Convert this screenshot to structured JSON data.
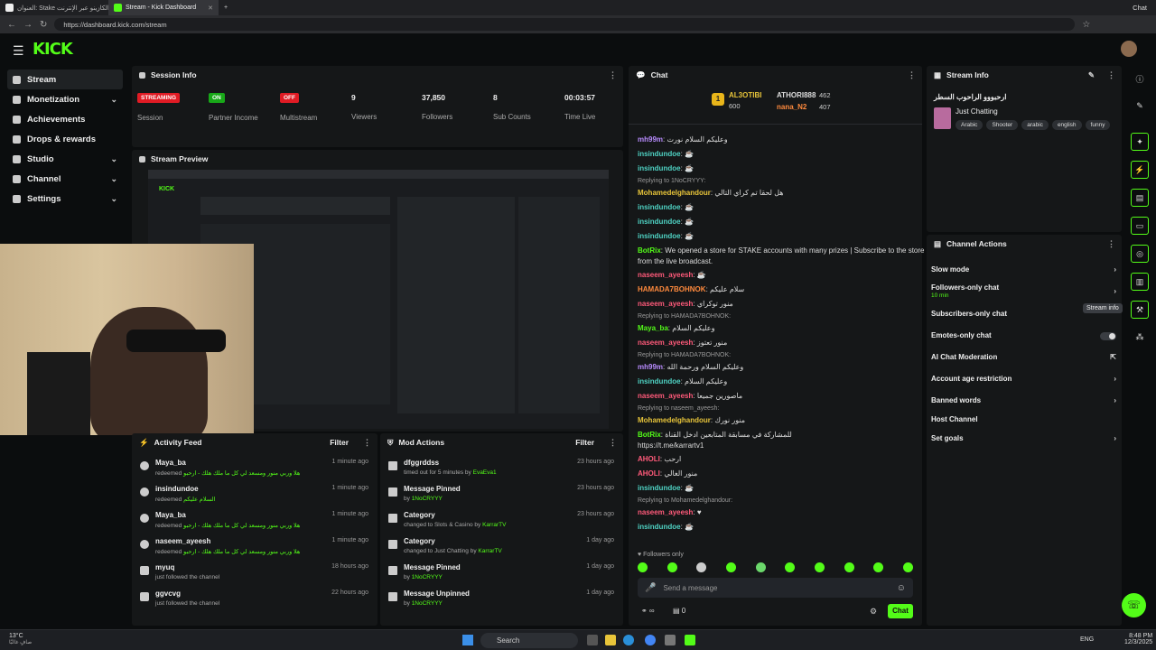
{
  "browser": {
    "tabs": [
      {
        "label": "العنوان: Stake الكازينو عبر الإنترنت"
      },
      {
        "label": "Stream - Kick Dashboard"
      }
    ],
    "url": "https://dashboard.kick.com/stream",
    "profile_label": "Chat"
  },
  "brand": {
    "logo": "KICK",
    "accent": "#53fc18"
  },
  "sidebar": {
    "items": [
      {
        "label": "Stream",
        "icon": "stream-icon"
      },
      {
        "label": "Monetization",
        "icon": "dollar-icon"
      },
      {
        "label": "Achievements",
        "icon": "trophy-icon"
      },
      {
        "label": "Drops & rewards",
        "icon": "gift-icon"
      },
      {
        "label": "Studio",
        "icon": "studio-icon"
      },
      {
        "label": "Channel",
        "icon": "channel-icon"
      },
      {
        "label": "Settings",
        "icon": "gear-icon"
      }
    ]
  },
  "session": {
    "title": "Session Info",
    "stats": [
      {
        "value": "STREAMING",
        "label": "Session",
        "color": "#e01b24"
      },
      {
        "value": "ON",
        "label": "Partner Income",
        "color": "#18a818"
      },
      {
        "value": "OFF",
        "label": "Multistream",
        "color": "#e01b24"
      },
      {
        "value": "9",
        "label": "Viewers"
      },
      {
        "value": "37,850",
        "label": "Followers"
      },
      {
        "value": "8",
        "label": "Sub Counts"
      },
      {
        "value": "00:03:57",
        "label": "Time Live"
      }
    ]
  },
  "preview": {
    "title": "Stream Preview"
  },
  "activity": {
    "title": "Activity Feed",
    "filter": "Filter",
    "rows": [
      {
        "name": "Maya_ba",
        "action": "redeemed",
        "reward": "هلا وربي منور ومسعد لي كل ما ملك هلك - ارحبو",
        "time": "1 minute ago"
      },
      {
        "name": "insindundoe",
        "action": "redeemed",
        "reward": "السلام عليكم",
        "time": "1 minute ago"
      },
      {
        "name": "Maya_ba",
        "action": "redeemed",
        "reward": "هلا وربي منور ومسعد لي كل ما ملك هلك - ارحبو",
        "time": "1 minute ago"
      },
      {
        "name": "naseem_ayeesh",
        "action": "redeemed",
        "reward": "هلا وربي منور ومسعد لي كل ما ملك هلك - ارحبو",
        "time": "1 minute ago"
      },
      {
        "name": "myuq",
        "action": "just followed the channel",
        "reward": "",
        "time": "18 hours ago"
      },
      {
        "name": "ggvcvg",
        "action": "just followed the channel",
        "reward": "",
        "time": "22 hours ago"
      }
    ]
  },
  "mod": {
    "title": "Mod Actions",
    "filter": "Filter",
    "rows": [
      {
        "title": "dfggrddss",
        "detail": "timed out for 5 minutes by",
        "by": "EvaEva1",
        "time": "23 hours ago",
        "icon": "hourglass-icon"
      },
      {
        "title": "Message Pinned",
        "detail": "by",
        "by": "1NoCRYYY",
        "time": "23 hours ago",
        "icon": "pin-icon"
      },
      {
        "title": "Category",
        "detail": "changed to Slots & Casino by",
        "by": "KarrarTV",
        "time": "23 hours ago",
        "icon": "category-icon"
      },
      {
        "title": "Category",
        "detail": "changed to Just Chatting by",
        "by": "KarrarTV",
        "time": "1 day ago",
        "icon": "category-icon"
      },
      {
        "title": "Message Pinned",
        "detail": "by",
        "by": "1NoCRYYY",
        "time": "1 day ago",
        "icon": "pin-icon"
      },
      {
        "title": "Message Unpinned",
        "detail": "by",
        "by": "1NoCRYYY",
        "time": "1 day ago",
        "icon": "unpin-icon"
      }
    ]
  },
  "chat": {
    "title": "Chat",
    "top": [
      {
        "rank": "1",
        "name": "AL3OTIBI",
        "score": "600"
      },
      {
        "rank": "",
        "name": "ATHORI888",
        "score": "462"
      },
      {
        "rank": "",
        "name": "nana_N2",
        "score": "407"
      }
    ],
    "messages": [
      {
        "user": "mh99m",
        "text": "وعليكم السلام نورت",
        "color": "#b98cff"
      },
      {
        "user": "insindundoe",
        "text": "☕",
        "color": "#4fd3c4"
      },
      {
        "user": "insindundoe",
        "text": "☕",
        "color": "#4fd3c4"
      },
      {
        "reply": "Replying to 1NoCRYYY:"
      },
      {
        "user": "Mohamedelghandour",
        "text": "هل لحقا تم كراي التالي",
        "color": "#e8c53a"
      },
      {
        "user": "insindundoe",
        "text": "☕",
        "color": "#4fd3c4"
      },
      {
        "user": "insindundoe",
        "text": "☕",
        "color": "#4fd3c4"
      },
      {
        "user": "insindundoe",
        "text": "☕",
        "color": "#4fd3c4"
      },
      {
        "user": "BotRix",
        "text": "We opened a store for STAKE accounts with many prizes | Subscribe to the store and collect points",
        "color": "#53fc18"
      },
      {
        "cont": "from the live broadcast."
      },
      {
        "user": "naseem_ayeesh",
        "text": "☕",
        "color": "#ff5a7a"
      },
      {
        "user": "HAMADA7BOHNOK",
        "text": "سلام عليكم",
        "color": "#ff8a3d"
      },
      {
        "user": "naseem_ayeesh",
        "text": "منور توكراي",
        "color": "#ff5a7a"
      },
      {
        "reply": "Replying to HAMADA7BOHNOK:"
      },
      {
        "user": "Maya_ba",
        "text": "وعليكم السلام",
        "color": "#53fc18"
      },
      {
        "user": "naseem_ayeesh",
        "text": "منور تعتوز",
        "color": "#ff5a7a"
      },
      {
        "reply": "Replying to HAMADA7BOHNOK:"
      },
      {
        "user": "mh99m",
        "text": "وعليكم السلام ورحمة الله",
        "color": "#b98cff"
      },
      {
        "user": "insindundoe",
        "text": "وعليكم السلام",
        "color": "#4fd3c4"
      },
      {
        "user": "naseem_ayeesh",
        "text": "ماصورين جميعا",
        "color": "#ff5a7a"
      },
      {
        "reply": "Replying to naseem_ayeesh:"
      },
      {
        "user": "Mohamedelghandour",
        "text": "منور نورك",
        "color": "#e8c53a"
      },
      {
        "user": "BotRix",
        "text": "للمشاركة في مسابقة المتابعين ادخل القناة",
        "color": "#53fc18"
      },
      {
        "cont": "https://t.me/karrartv1"
      },
      {
        "user": "AHOLI",
        "text": "ارحب",
        "color": "#ff5a7a"
      },
      {
        "user": "AHOLI",
        "text": "منور الغالي",
        "color": "#ff5a7a"
      },
      {
        "user": "insindundoe",
        "text": "☕",
        "color": "#4fd3c4"
      },
      {
        "reply": "Replying to Mohamedelghandour:"
      },
      {
        "user": "naseem_ayeesh",
        "text": "♥",
        "color": "#ff5a7a"
      },
      {
        "user": "insindundoe",
        "text": "☕",
        "color": "#4fd3c4"
      }
    ],
    "followers_only": "Followers only",
    "placeholder": "Send a message",
    "count": "0",
    "send": "Chat"
  },
  "stream_info": {
    "title": "Stream Info",
    "stream_title": "ارحبووو الراحوب السطر",
    "category": "Just Chatting",
    "tags": [
      "Arabic",
      "Shooter",
      "arabic",
      "english",
      "funny"
    ]
  },
  "channel_actions": {
    "title": "Channel Actions",
    "items": [
      {
        "label": "Slow mode",
        "sub": ""
      },
      {
        "label": "Followers-only chat",
        "sub": "10 min"
      },
      {
        "label": "Subscribers-only chat",
        "sub": ""
      },
      {
        "label": "Emotes-only chat",
        "sub": ""
      },
      {
        "label": "AI Chat Moderation",
        "sub": ""
      },
      {
        "label": "Account age restriction",
        "sub": ""
      },
      {
        "label": "Banned words",
        "sub": ""
      },
      {
        "label": "Host Channel",
        "sub": ""
      },
      {
        "label": "Set goals",
        "sub": ""
      }
    ],
    "tooltip": "Stream info"
  },
  "taskbar": {
    "weather": "13°C",
    "weather_sub": "صافٍ غالبًا",
    "search": "Search",
    "lang": "ENG",
    "time": "8:48 PM",
    "date": "12/3/2025"
  }
}
